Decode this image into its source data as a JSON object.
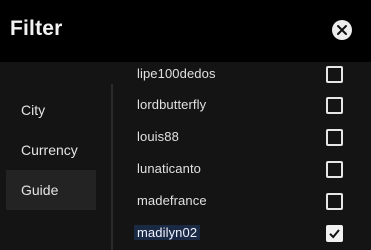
{
  "header": {
    "title": "Filter",
    "close_icon": "close-icon"
  },
  "sidebar": {
    "items": [
      {
        "label": "City",
        "active": false
      },
      {
        "label": "Currency",
        "active": false
      },
      {
        "label": "Guide",
        "active": true
      }
    ]
  },
  "list": {
    "items": [
      {
        "label": "lipe100dedos",
        "checked": false
      },
      {
        "label": "lordbutterfly",
        "checked": false
      },
      {
        "label": "louis88",
        "checked": false
      },
      {
        "label": "lunaticanto",
        "checked": false
      },
      {
        "label": "madefrance",
        "checked": false
      },
      {
        "label": "madilyn02",
        "checked": true,
        "selected": true
      }
    ]
  },
  "colors": {
    "background": "#000000",
    "panel": "#141414",
    "active_sidebar": "#232323",
    "selection_highlight": "#1b2a44"
  }
}
